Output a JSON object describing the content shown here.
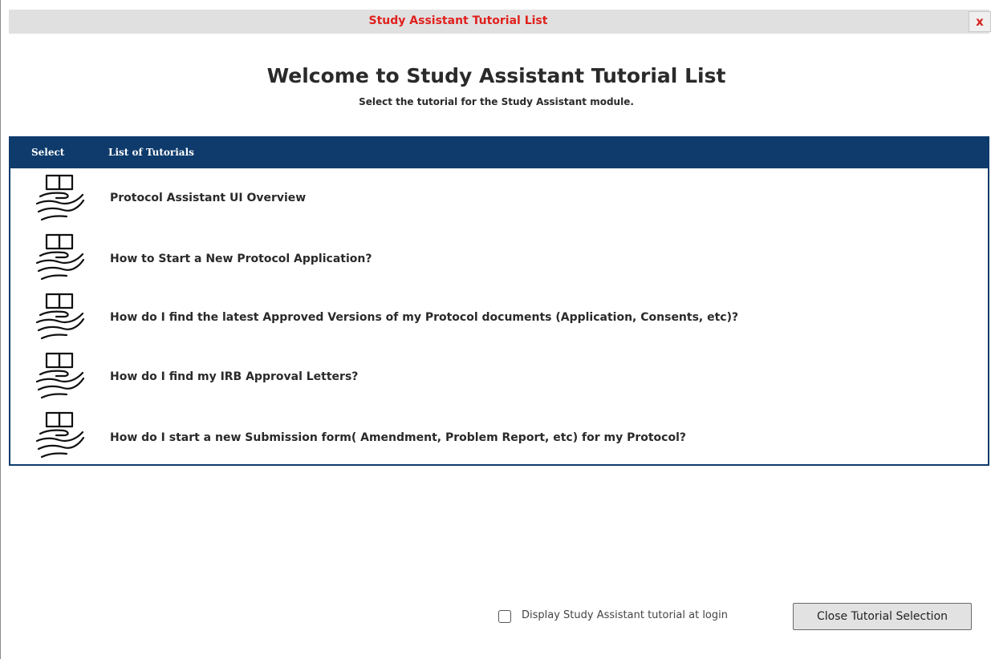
{
  "window": {
    "title": "Study Assistant Tutorial List",
    "close_label": "x"
  },
  "welcome": {
    "title": "Welcome to Study Assistant Tutorial List",
    "subtitle": "Select the tutorial for the Study Assistant module."
  },
  "table": {
    "headers": {
      "select": "Select",
      "list": "List of Tutorials"
    },
    "rows": [
      {
        "icon": "open-book-hand-icon",
        "label": "Protocol Assistant UI Overview"
      },
      {
        "icon": "open-book-hand-icon",
        "label": "How to Start a New Protocol Application?"
      },
      {
        "icon": "open-book-hand-icon",
        "label": "How do I find the latest Approved Versions of my Protocol documents (Application, Consents, etc)?"
      },
      {
        "icon": "open-book-hand-icon",
        "label": "How do I find my IRB Approval Letters?"
      },
      {
        "icon": "open-book-hand-icon",
        "label": "How do I start a new Submission form( Amendment, Problem Report, etc) for my Protocol?"
      }
    ]
  },
  "footer": {
    "checkbox_label": "Display Study Assistant tutorial at login",
    "checkbox_checked": false,
    "close_button_label": "Close Tutorial Selection"
  },
  "colors": {
    "title_text": "#e0211d",
    "header_bg": "#0e3b6c",
    "titlebar_bg": "#e0e0e0"
  }
}
